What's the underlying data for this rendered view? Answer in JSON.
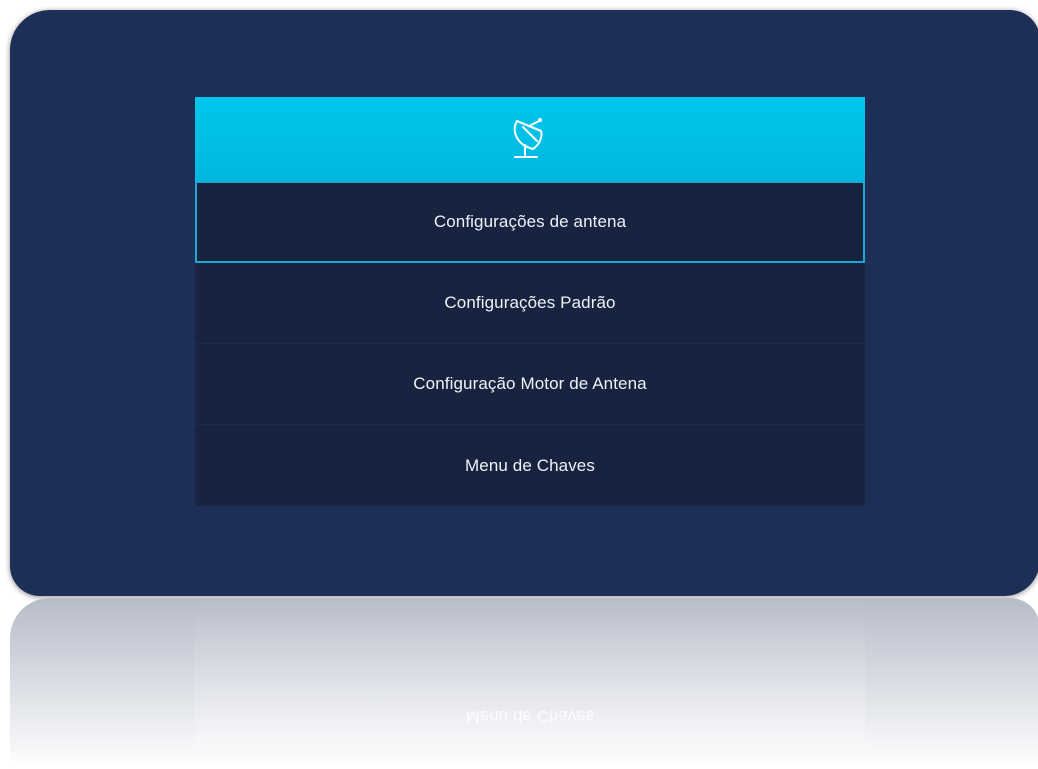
{
  "header": {
    "icon": "satellite-dish-icon",
    "accent_color": "#00c2ea"
  },
  "menu": {
    "selected_index": 0,
    "items": [
      {
        "label": "Configurações de antena"
      },
      {
        "label": "Configurações Padrão"
      },
      {
        "label": "Configuração Motor de Antena"
      },
      {
        "label": "Menu de Chaves"
      }
    ]
  },
  "reflection": {
    "text": "Menu de Chaves"
  },
  "colors": {
    "background": "#1e2f57",
    "item_background": "#17233f",
    "selection_border": "#1aa9d6",
    "text": "#eef2f8"
  }
}
